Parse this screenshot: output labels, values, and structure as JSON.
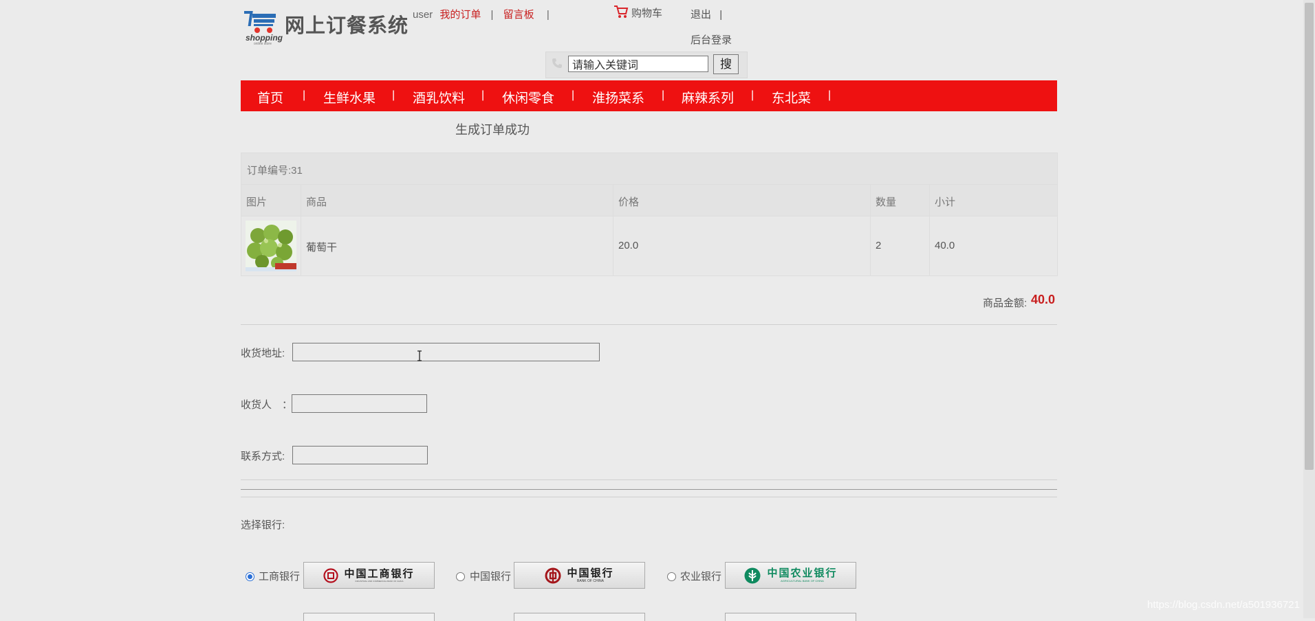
{
  "header": {
    "logo_title": "网上订餐系统",
    "logo_subtitle": "shopping",
    "logo_tagline": "online store",
    "user": "user",
    "my_orders": "我的订单",
    "guestbook": "留言板",
    "sep": "|",
    "cart": "购物车",
    "logout": "退出",
    "admin_login": "后台登录"
  },
  "search": {
    "value": "请输入关键词",
    "button": "搜"
  },
  "nav": {
    "items": [
      "首页",
      "生鲜水果",
      "酒乳饮料",
      "休闲零食",
      "淮扬菜系",
      "麻辣系列",
      "东北菜"
    ],
    "sep": "|"
  },
  "page_title": "生成订单成功",
  "order": {
    "number_label": "订单编号:31",
    "columns": [
      "图片",
      "商品",
      "价格",
      "数量",
      "小计"
    ],
    "rows": [
      {
        "name": "葡萄干",
        "price": "20.0",
        "qty": "2",
        "subtotal": "40.0"
      }
    ],
    "total_label": "商品金额:",
    "total_value": "40.0"
  },
  "form": {
    "address_label": "收货地址:",
    "receiver_label": "收货人　：",
    "contact_label": "联系方式:",
    "address_value": "",
    "receiver_value": "",
    "contact_value": ""
  },
  "bank": {
    "label": "选择银行:",
    "options": [
      {
        "name": "工商银行",
        "logo_text": "中国工商银行",
        "logo_sub": "INDUSTRIAL AND COMMERCIAL BANK OF CHINA",
        "selected": true,
        "color": "#b4101e"
      },
      {
        "name": "中国银行",
        "logo_text": "中国银行",
        "logo_sub": "BANK OF CHINA",
        "selected": false,
        "color": "#a4161b"
      },
      {
        "name": "农业银行",
        "logo_text": "中国农业银行",
        "logo_sub": "AGRICULTURAL BANK OF CHINA",
        "selected": false,
        "color": "#0f8a5f"
      }
    ]
  },
  "watermark": "https://blog.csdn.net/a501936721",
  "colors": {
    "nav_bg": "#ee1111",
    "accent_red": "#c81e1e"
  }
}
